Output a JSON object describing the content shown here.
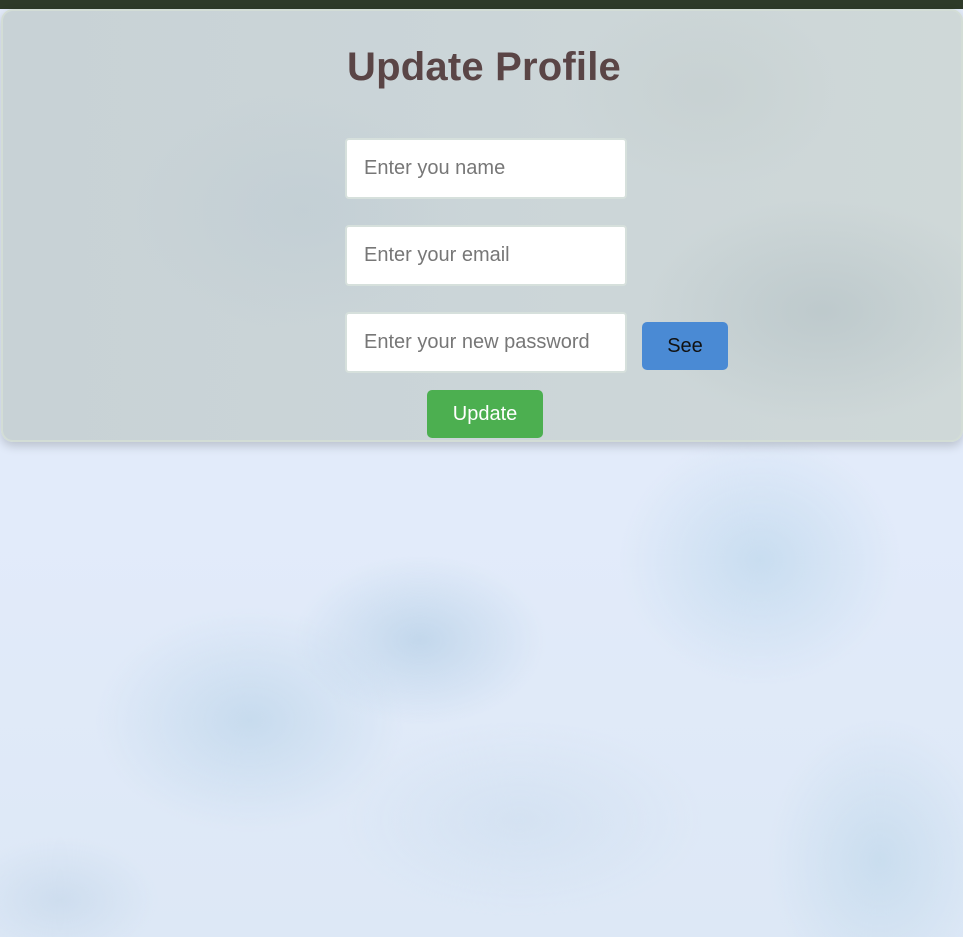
{
  "page": {
    "title": "Update Profile"
  },
  "form": {
    "name": {
      "placeholder": "Enter you name",
      "value": ""
    },
    "email": {
      "placeholder": "Enter your email",
      "value": ""
    },
    "password": {
      "placeholder": "Enter your new password",
      "value": ""
    },
    "see_label": "See",
    "update_label": "Update"
  },
  "colors": {
    "top_bar": "#2e3a29",
    "title": "#5a4546",
    "see_button": "#4a8ad4",
    "update_button": "#4caf50"
  }
}
